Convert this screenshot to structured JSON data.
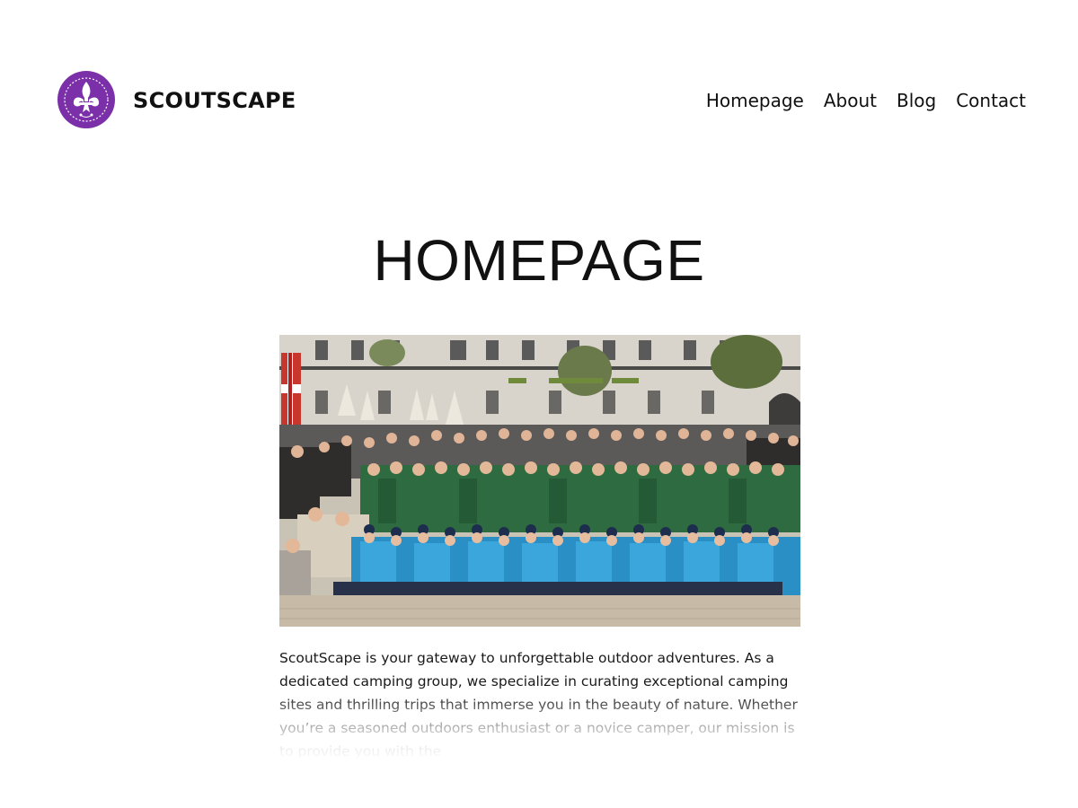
{
  "header": {
    "site_title": "SCOUTSCAPE",
    "logo_icon": "fleur-de-lis-icon",
    "brand_color": "#7b2fa8"
  },
  "nav": {
    "items": [
      {
        "label": "Homepage"
      },
      {
        "label": "About"
      },
      {
        "label": "Blog"
      },
      {
        "label": "Contact"
      }
    ]
  },
  "main": {
    "page_title": "HOMEPAGE",
    "hero_image": "scouts-group-photo",
    "intro_text": "ScoutScape is your gateway to unforgettable outdoor adventures. As a dedicated camping group, we specialize in curating exceptional camping sites and thrilling trips that immerse you in the beauty of nature. Whether you’re a seasoned outdoors enthusiast or a novice camper, our mission is to provide you with the"
  }
}
